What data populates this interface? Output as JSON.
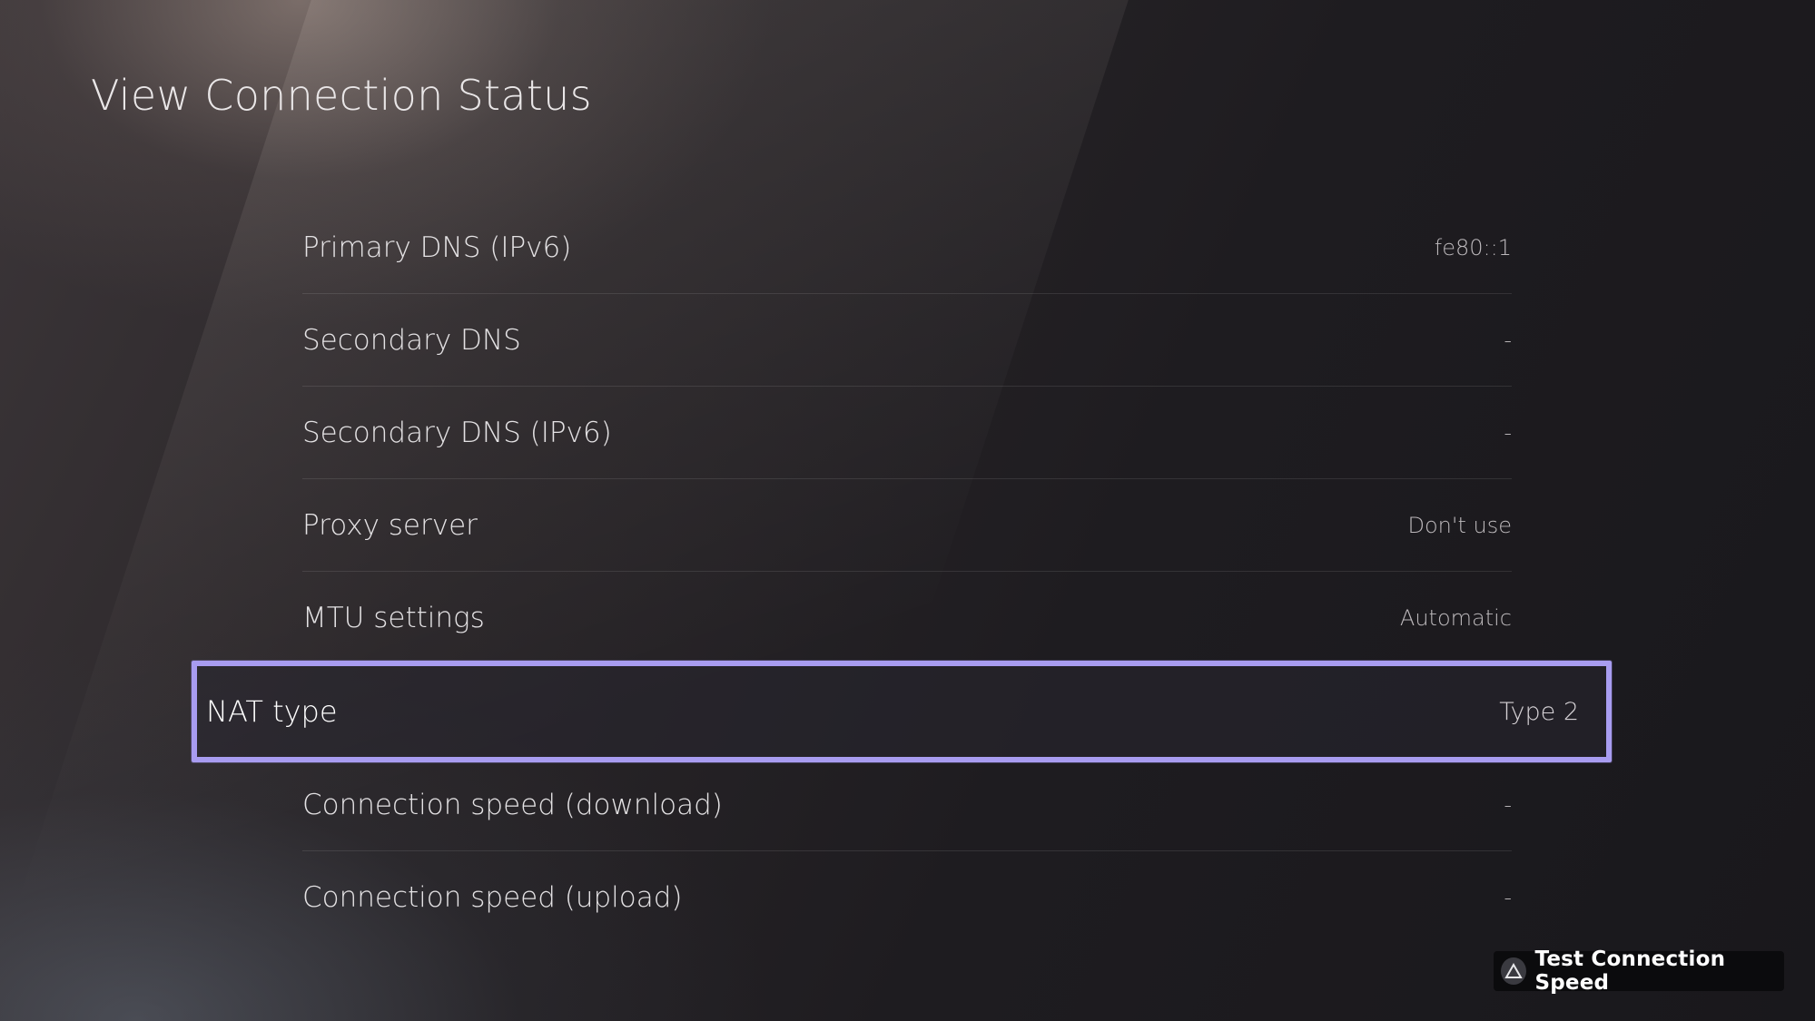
{
  "header": {
    "title": "View Connection Status"
  },
  "rows": [
    {
      "label": "Primary DNS (IPv6)",
      "value": "fe80::1"
    },
    {
      "label": "Secondary DNS",
      "value": "-"
    },
    {
      "label": "Secondary DNS (IPv6)",
      "value": "-"
    },
    {
      "label": "Proxy server",
      "value": "Don't use"
    },
    {
      "label": "MTU settings",
      "value": "Automatic"
    },
    {
      "label": "NAT type",
      "value": "Type 2",
      "selected": true
    },
    {
      "label": "Connection speed (download)",
      "value": "-"
    },
    {
      "label": "Connection speed (upload)",
      "value": "-"
    }
  ],
  "footer": {
    "action_label": "Test Connection Speed",
    "action_icon": "triangle-button-icon"
  },
  "colors": {
    "focus_border": "#a89cf0",
    "text_primary": "#e4e2e4",
    "text_secondary": "#bdb9bc"
  }
}
